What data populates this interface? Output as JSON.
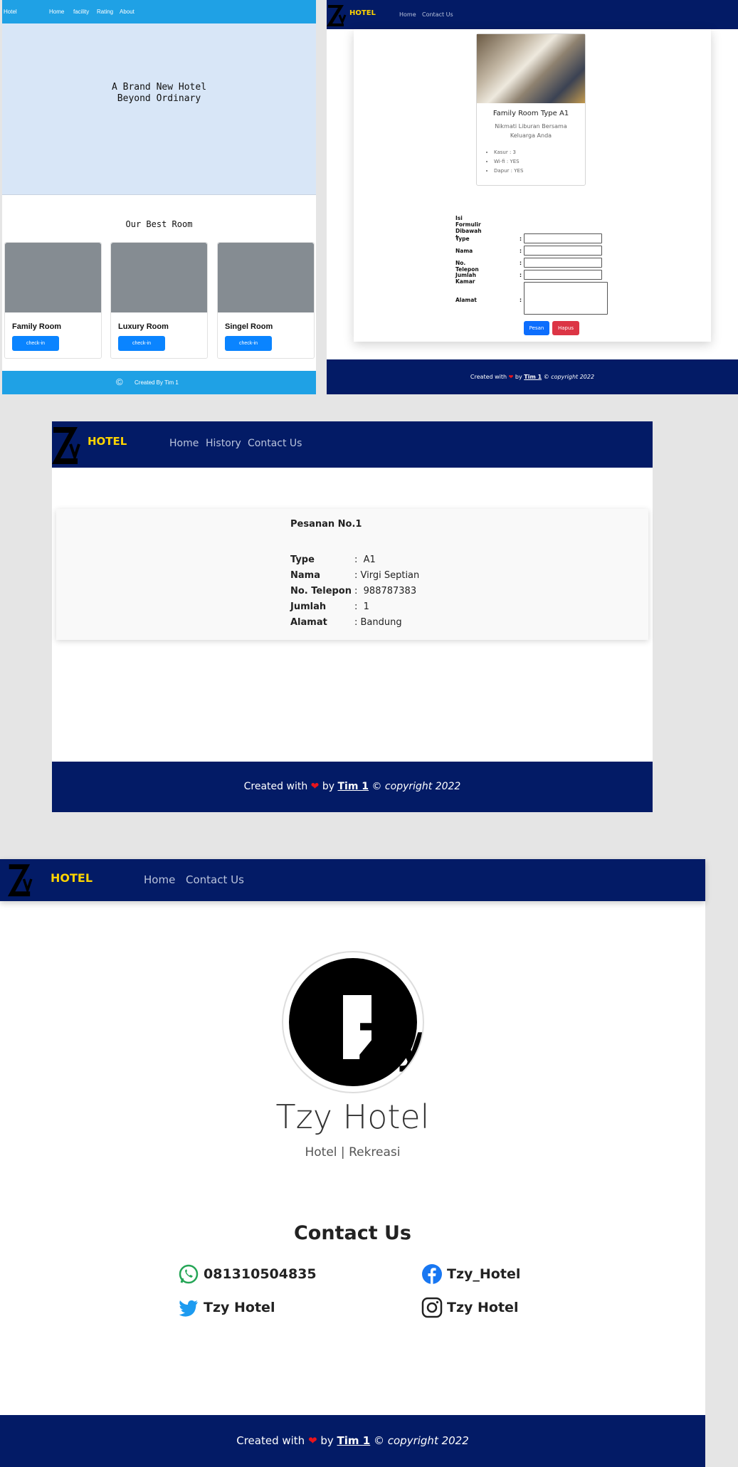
{
  "panel_a": {
    "nav": {
      "brand": "Hotel",
      "links": [
        "Home",
        "facility",
        "Rating",
        "About"
      ]
    },
    "hero": {
      "line1": "A Brand New Hotel",
      "line2": "Beyond Ordinary"
    },
    "section_title": "Our Best Room",
    "rooms": [
      {
        "name": "Family Room",
        "button": "check-in"
      },
      {
        "name": "Luxury Room",
        "button": "check-in"
      },
      {
        "name": "Singel Room",
        "button": "check-in"
      }
    ],
    "footer": {
      "symbol": "©",
      "text": "Created By Tim 1"
    },
    "colors": {
      "nav": "#1fa1e5",
      "hero": "#d8e6f7",
      "button": "#0a84ff"
    }
  },
  "panel_b": {
    "nav": {
      "brand": "HOTEL",
      "links": [
        "Home",
        "Contact Us"
      ]
    },
    "room_card": {
      "title": "Family Room Type A1",
      "subtitle": "Nikmati Liburan Bersama Keluarga Anda",
      "features": [
        "Kasur : 3",
        "Wi-fi : YES",
        "Dapur : YES"
      ]
    },
    "form": {
      "heading": "Isi Formulir Dibawah !",
      "fields": [
        "Type",
        "Nama",
        "No. Telepon",
        "Jumlah Kamar",
        "Alamat"
      ],
      "submit": "Pesan",
      "reset": "Hapus"
    },
    "footer": {
      "prefix": "Created with",
      "by": "by",
      "team": "Tim 1",
      "copyright": "© copyright 2022"
    }
  },
  "panel_c": {
    "nav": {
      "brand": "HOTEL",
      "links": [
        "Home",
        "History",
        "Contact Us"
      ]
    },
    "order": {
      "title": "Pesanan No.1",
      "rows": [
        {
          "label": "Type",
          "value": "A1"
        },
        {
          "label": "Nama",
          "value": "Virgi Septian"
        },
        {
          "label": "No. Telepon",
          "value": "988787383"
        },
        {
          "label": "Jumlah",
          "value": "1"
        },
        {
          "label": "Alamat",
          "value": "Bandung"
        }
      ]
    },
    "footer": {
      "prefix": "Created with",
      "by": "by",
      "team": "Tim 1",
      "copyright": "© copyright 2022"
    }
  },
  "panel_d": {
    "nav": {
      "brand": "HOTEL",
      "links": [
        "Home",
        "Contact Us"
      ]
    },
    "profile": {
      "name": "Tzy Hotel",
      "tagline": "Hotel | Rekreasi",
      "logo_text": "Zy"
    },
    "contact": {
      "title": "Contact Us",
      "whatsapp": "081310504835",
      "facebook": "Tzy_Hotel",
      "twitter": "Tzy Hotel",
      "instagram": "Tzy Hotel"
    },
    "footer": {
      "prefix": "Created with",
      "by": "by",
      "team": "Tim 1",
      "copyright": "© copyright 2022"
    }
  },
  "theme": {
    "navy": "#031b66",
    "brand_yellow": "#ffd400",
    "danger": "#dc3545",
    "primary": "#0d6efd"
  }
}
